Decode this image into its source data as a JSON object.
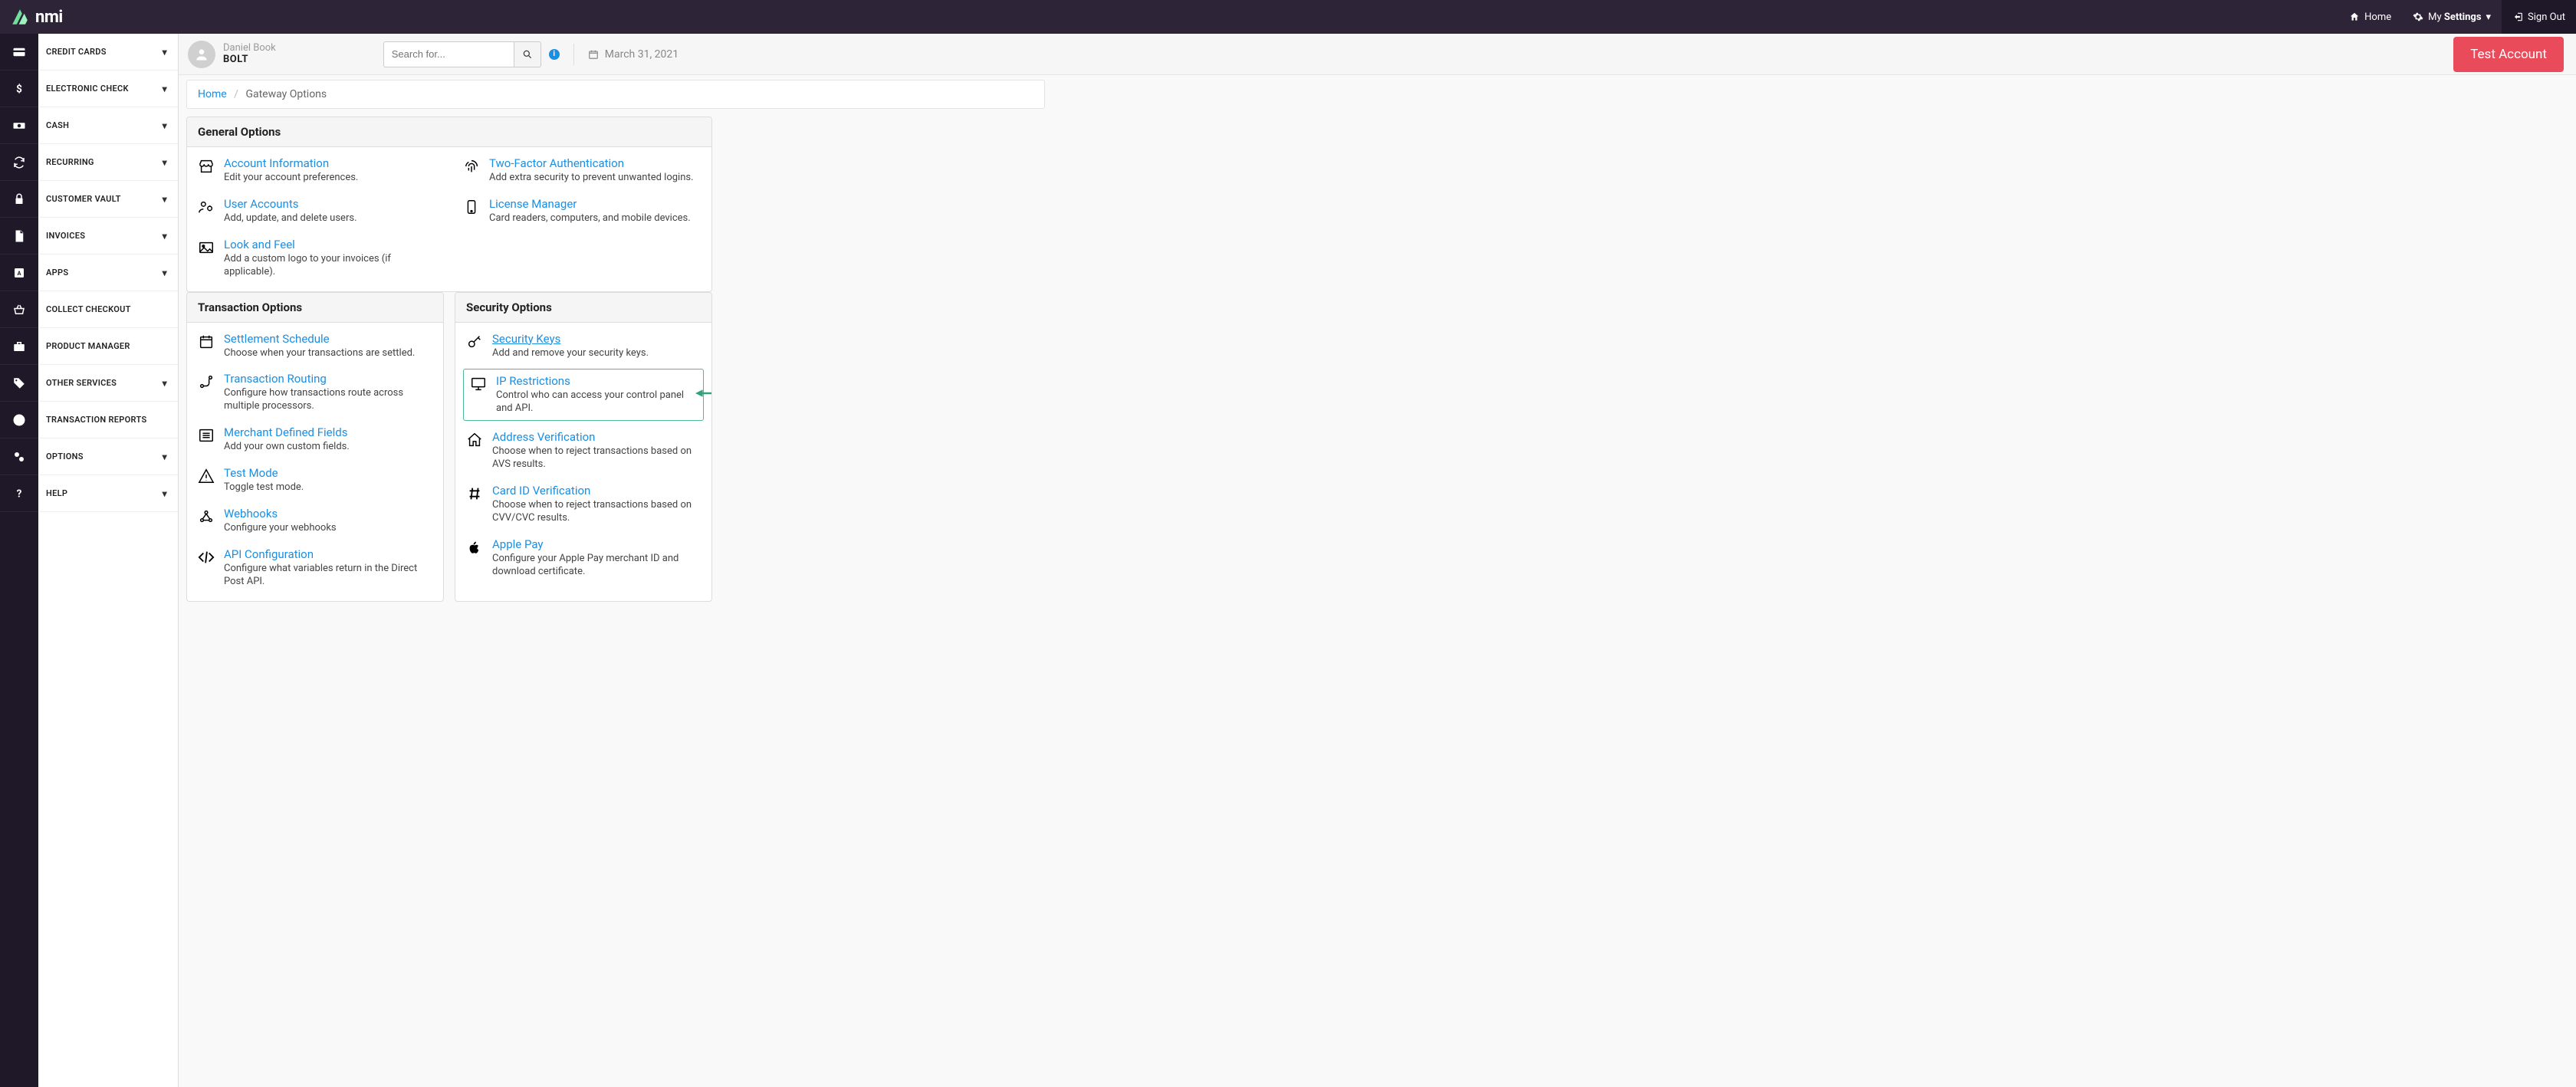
{
  "brand": {
    "name": "nmi"
  },
  "header": {
    "home": "Home",
    "settings_pre": "My ",
    "settings_bold": "Settings",
    "signout": "Sign Out"
  },
  "sidebar": {
    "items": [
      {
        "label": "CREDIT CARDS",
        "chevron": true
      },
      {
        "label": "ELECTRONIC CHECK",
        "chevron": true
      },
      {
        "label": "CASH",
        "chevron": true
      },
      {
        "label": "RECURRING",
        "chevron": true
      },
      {
        "label": "CUSTOMER VAULT",
        "chevron": true
      },
      {
        "label": "INVOICES",
        "chevron": true
      },
      {
        "label": "APPS",
        "chevron": true
      },
      {
        "label": "COLLECT CHECKOUT",
        "chevron": false
      },
      {
        "label": "PRODUCT MANAGER",
        "chevron": false
      },
      {
        "label": "OTHER SERVICES",
        "chevron": true
      },
      {
        "label": "TRANSACTION REPORTS",
        "chevron": false
      },
      {
        "label": "OPTIONS",
        "chevron": true
      },
      {
        "label": "HELP",
        "chevron": true
      }
    ]
  },
  "subheader": {
    "user_name": "Daniel Book",
    "company": "BOLT",
    "search_placeholder": "Search for...",
    "date": "March 31, 2021",
    "test_btn": "Test Account"
  },
  "breadcrumb": {
    "home": "Home",
    "current": "Gateway Options"
  },
  "panels": {
    "general": {
      "title": "General Options",
      "left": [
        {
          "title": "Account Information",
          "desc": "Edit your account preferences."
        },
        {
          "title": "User Accounts",
          "desc": "Add, update, and delete users."
        },
        {
          "title": "Look and Feel",
          "desc": "Add a custom logo to your invoices (if applicable)."
        }
      ],
      "right": [
        {
          "title": "Two-Factor Authentication",
          "desc": "Add extra security to prevent unwanted logins."
        },
        {
          "title": "License Manager",
          "desc": "Card readers, computers, and mobile devices."
        }
      ]
    },
    "transaction": {
      "title": "Transaction Options",
      "items": [
        {
          "title": "Settlement Schedule",
          "desc": "Choose when your transactions are settled."
        },
        {
          "title": "Transaction Routing",
          "desc": "Configure how transactions route across multiple processors."
        },
        {
          "title": "Merchant Defined Fields",
          "desc": "Add your own custom fields."
        },
        {
          "title": "Test Mode",
          "desc": "Toggle test mode."
        },
        {
          "title": "Webhooks",
          "desc": "Configure your webhooks"
        },
        {
          "title": "API Configuration",
          "desc": "Configure what variables return in the Direct Post API."
        }
      ]
    },
    "security": {
      "title": "Security Options",
      "items": [
        {
          "title": "Security Keys",
          "desc": "Add and remove your security keys.",
          "underlined": true
        },
        {
          "title": "IP Restrictions",
          "desc": "Control who can access your control panel and API.",
          "highlight": true
        },
        {
          "title": "Address Verification",
          "desc": "Choose when to reject transactions based on AVS results."
        },
        {
          "title": "Card ID Verification",
          "desc": "Choose when to reject transactions based on CVV/CVC results."
        },
        {
          "title": "Apple Pay",
          "desc": "Configure your Apple Pay merchant ID and download certificate."
        }
      ]
    }
  }
}
